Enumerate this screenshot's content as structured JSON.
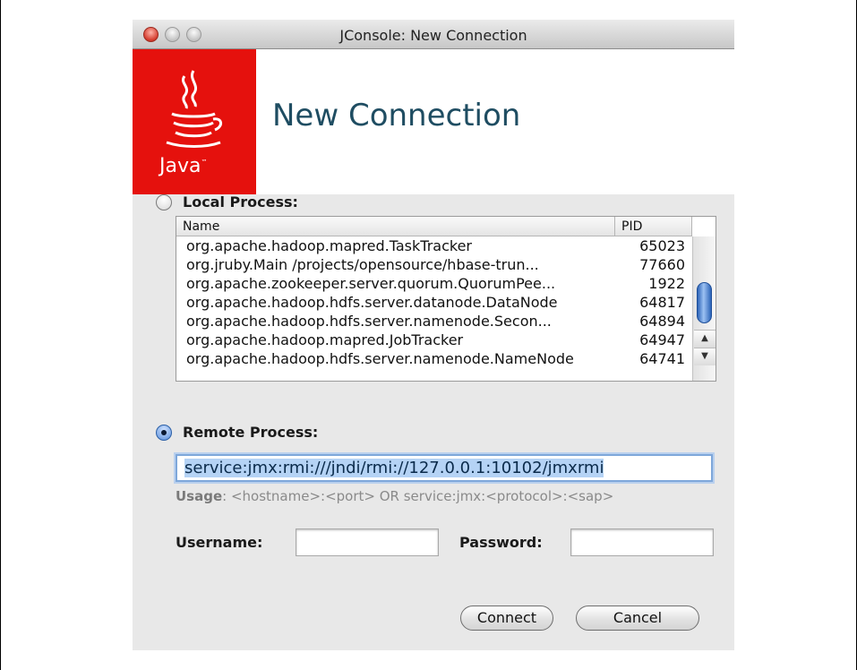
{
  "window": {
    "title": "JConsole: New Connection"
  },
  "banner": {
    "logo_text": "Java",
    "logo_tm": "™",
    "title": "New Connection"
  },
  "local": {
    "label": "Local Process:",
    "selected": false,
    "columns": {
      "name": "Name",
      "pid": "PID"
    },
    "rows": [
      {
        "name": "org.apache.hadoop.mapred.TaskTracker",
        "pid": "65023"
      },
      {
        "name": "org.jruby.Main /projects/opensource/hbase-trun...",
        "pid": "77660"
      },
      {
        "name": "org.apache.zookeeper.server.quorum.QuorumPee...",
        "pid": "1922"
      },
      {
        "name": "org.apache.hadoop.hdfs.server.datanode.DataNode",
        "pid": "64817"
      },
      {
        "name": "org.apache.hadoop.hdfs.server.namenode.Secon...",
        "pid": "64894"
      },
      {
        "name": "org.apache.hadoop.mapred.JobTracker",
        "pid": "64947"
      },
      {
        "name": "org.apache.hadoop.hdfs.server.namenode.NameNode",
        "pid": "64741"
      }
    ]
  },
  "remote": {
    "label": "Remote Process:",
    "selected": true,
    "url": "service:jmx:rmi:///jndi/rmi://127.0.0.1:10102/jmxrmi",
    "usage_label": "Usage",
    "usage_text": ": <hostname>:<port> OR service:jmx:<protocol>:<sap>"
  },
  "credentials": {
    "username_label": "Username:",
    "password_label": "Password:",
    "username": "",
    "password": ""
  },
  "buttons": {
    "connect": "Connect",
    "cancel": "Cancel"
  },
  "colors": {
    "java_red": "#e5110d",
    "title_blue": "#1f4d62",
    "selection_blue": "#b5d3f5"
  }
}
